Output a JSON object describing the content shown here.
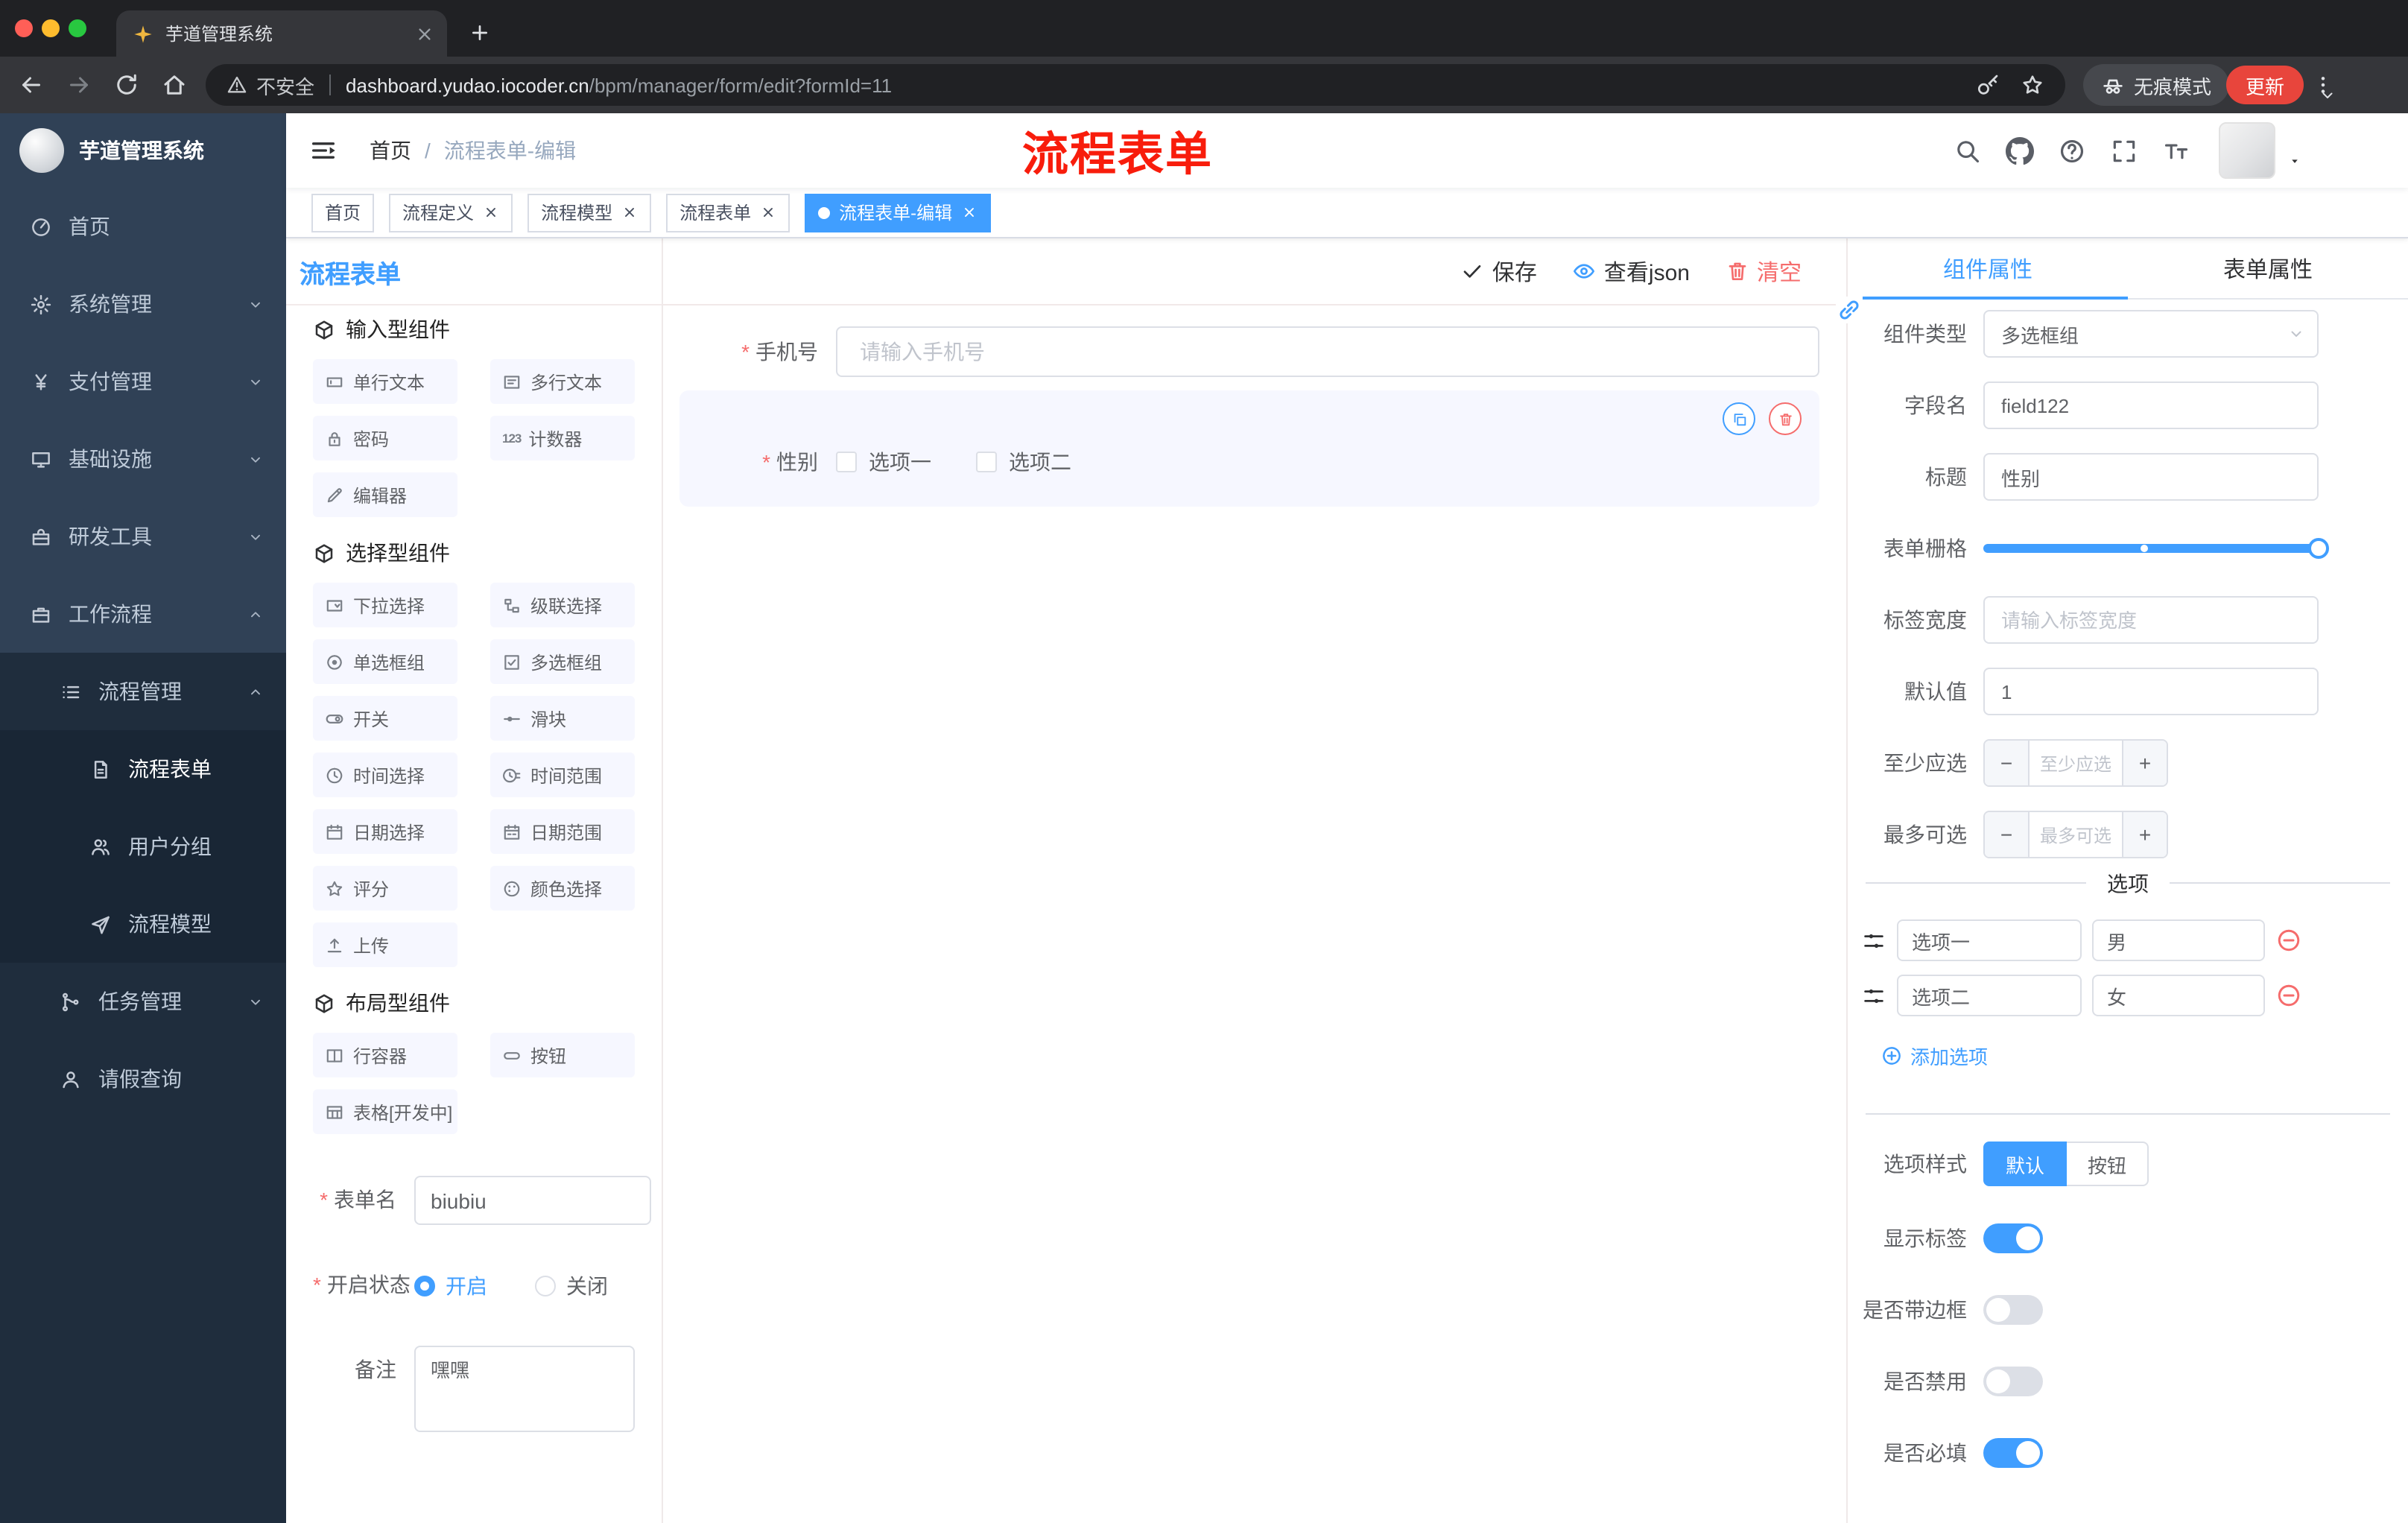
{
  "browser": {
    "tab_title": "芋道管理系统",
    "security_label": "不安全",
    "url_host": "dashboard.yudao.iocoder.cn",
    "url_path": "/bpm/manager/form/edit?formId=11",
    "incognito_label": "无痕模式",
    "update_label": "更新"
  },
  "annotation": {
    "text": "流程表单"
  },
  "sidebar": {
    "logo_title": "芋道管理系统",
    "items": [
      {
        "label": "首页",
        "icon": "dashboard",
        "level": 0
      },
      {
        "label": "系统管理",
        "icon": "gear",
        "level": 0,
        "chevron": "down"
      },
      {
        "label": "支付管理",
        "icon": "yen",
        "level": 0,
        "chevron": "down"
      },
      {
        "label": "基础设施",
        "icon": "monitor",
        "level": 0,
        "chevron": "down"
      },
      {
        "label": "研发工具",
        "icon": "toolbox",
        "level": 0,
        "chevron": "down"
      },
      {
        "label": "工作流程",
        "icon": "briefcase",
        "level": 0,
        "chevron": "up"
      },
      {
        "label": "流程管理",
        "icon": "list",
        "level": 1,
        "chevron": "up"
      },
      {
        "label": "流程表单",
        "icon": "document",
        "level": 2,
        "active": true
      },
      {
        "label": "用户分组",
        "icon": "users",
        "level": 2
      },
      {
        "label": "流程模型",
        "icon": "send",
        "level": 2
      },
      {
        "label": "任务管理",
        "icon": "branch",
        "level": 1,
        "chevron": "down"
      },
      {
        "label": "请假查询",
        "icon": "person",
        "level": 1
      }
    ]
  },
  "navbar": {
    "breadcrumb": [
      "首页",
      "流程表单-编辑"
    ]
  },
  "tags": [
    {
      "label": "首页",
      "closable": false,
      "active": false
    },
    {
      "label": "流程定义",
      "closable": true,
      "active": false
    },
    {
      "label": "流程模型",
      "closable": true,
      "active": false
    },
    {
      "label": "流程表单",
      "closable": true,
      "active": false
    },
    {
      "label": "流程表单-编辑",
      "closable": true,
      "active": true
    }
  ],
  "designer": {
    "panel_title": "流程表单",
    "actions": {
      "save": "保存",
      "view_json": "查看json",
      "clear": "清空"
    },
    "palette": {
      "groups": [
        {
          "title": "输入型组件",
          "items": [
            {
              "label": "单行文本",
              "icon": "text-field"
            },
            {
              "label": "多行文本",
              "icon": "textarea"
            },
            {
              "label": "密码",
              "icon": "lock"
            },
            {
              "label": "计数器",
              "icon": "counter"
            },
            {
              "label": "编辑器",
              "icon": "editor"
            }
          ]
        },
        {
          "title": "选择型组件",
          "items": [
            {
              "label": "下拉选择",
              "icon": "dropdown"
            },
            {
              "label": "级联选择",
              "icon": "cascader"
            },
            {
              "label": "单选框组",
              "icon": "radio-group"
            },
            {
              "label": "多选框组",
              "icon": "checkbox-group"
            },
            {
              "label": "开关",
              "icon": "switch"
            },
            {
              "label": "滑块",
              "icon": "slider"
            },
            {
              "label": "时间选择",
              "icon": "time"
            },
            {
              "label": "时间范围",
              "icon": "time-range"
            },
            {
              "label": "日期选择",
              "icon": "date"
            },
            {
              "label": "日期范围",
              "icon": "date-range"
            },
            {
              "label": "评分",
              "icon": "star"
            },
            {
              "label": "颜色选择",
              "icon": "color"
            },
            {
              "label": "上传",
              "icon": "upload"
            }
          ]
        },
        {
          "title": "布局型组件",
          "items": [
            {
              "label": "行容器",
              "icon": "row-container"
            },
            {
              "label": "按钮",
              "icon": "button"
            },
            {
              "label": "表格[开发中]",
              "icon": "table"
            }
          ]
        }
      ]
    },
    "meta_form": {
      "name_label": "表单名",
      "name_value": "biubiu",
      "status_label": "开启状态",
      "status_options": [
        {
          "label": "开启",
          "checked": true
        },
        {
          "label": "关闭",
          "checked": false
        }
      ],
      "remark_label": "备注",
      "remark_value": "嘿嘿"
    },
    "canvas": {
      "phone": {
        "label": "手机号",
        "required": true,
        "placeholder": "请输入手机号"
      },
      "gender": {
        "label": "性别",
        "required": true,
        "options": [
          "选项一",
          "选项二"
        ],
        "selected": true
      }
    },
    "properties": {
      "tabs": [
        {
          "label": "组件属性",
          "active": true
        },
        {
          "label": "表单属性",
          "active": false
        }
      ],
      "fields": [
        {
          "label": "组件类型",
          "type": "select",
          "value": "多选框组"
        },
        {
          "label": "字段名",
          "type": "input",
          "value": "field122"
        },
        {
          "label": "标题",
          "type": "input",
          "value": "性别"
        },
        {
          "label": "表单栅格",
          "type": "slider"
        },
        {
          "label": "标签宽度",
          "type": "input",
          "placeholder": "请输入标签宽度"
        },
        {
          "label": "默认值",
          "type": "input",
          "value": "1"
        },
        {
          "label": "至少应选",
          "type": "stepper",
          "placeholder": "至少应选"
        },
        {
          "label": "最多可选",
          "type": "stepper",
          "placeholder": "最多可选"
        }
      ],
      "options_title": "选项",
      "options": [
        {
          "name": "选项一",
          "value": "男"
        },
        {
          "name": "选项二",
          "value": "女"
        }
      ],
      "add_option_label": "添加选项",
      "style_label": "选项样式",
      "style_options": [
        {
          "label": "默认",
          "active": true
        },
        {
          "label": "按钮",
          "active": false
        }
      ],
      "switches": [
        {
          "label": "显示标签",
          "on": true
        },
        {
          "label": "是否带边框",
          "on": false
        },
        {
          "label": "是否禁用",
          "on": false
        },
        {
          "label": "是否必填",
          "on": true
        }
      ]
    }
  },
  "colors": {
    "primary": "#409eff",
    "danger": "#f56c6c",
    "sidebar_bg": "#304156",
    "submenu_bg": "#1f2d3d",
    "annotation_red": "#f81d0c",
    "active_tag_bg": "#409eff"
  }
}
